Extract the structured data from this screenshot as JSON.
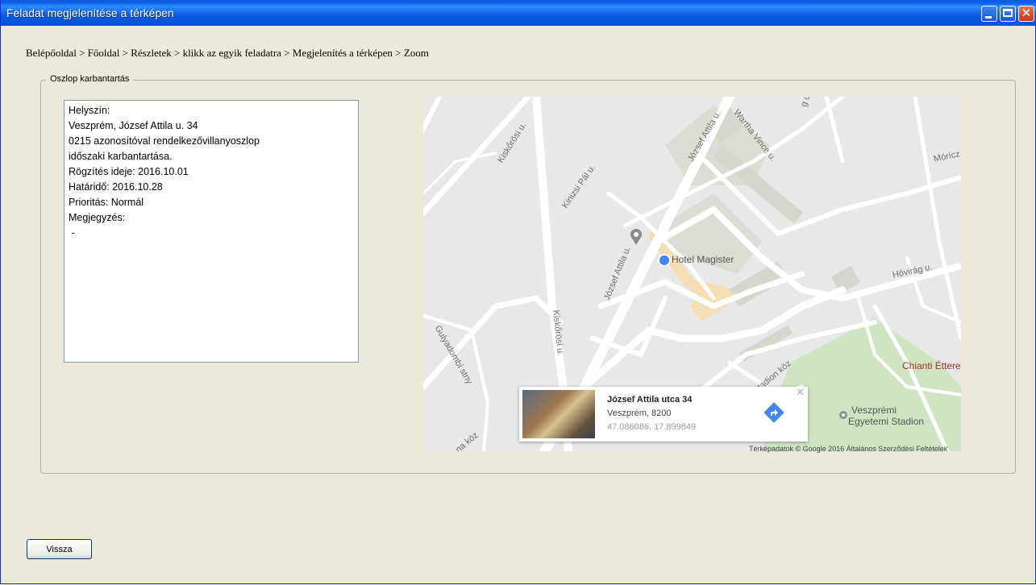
{
  "window": {
    "title": "Feladat megjelenítése a térképen",
    "minimize_symbol": "",
    "maximize_symbol": "",
    "close_symbol": "✕"
  },
  "breadcrumb": "Belépőoldal > Főoldal > Részletek > klikk az egyik feladatra > Megjelenítés a térképen  > Zoom",
  "group": {
    "legend": "Oszlop karbantartás",
    "lines": [
      "Helyszín:",
      "Veszprém, József Attila u. 34",
      "0215 azonosítóval rendelkezővillanyoszlop",
      "időszaki karbantartása.",
      "Rögzítés ideje: 2016.10.01",
      "Határidő: 2016.10.28",
      "Prioritás: Normál",
      "Megjegyzés:",
      " -"
    ]
  },
  "map": {
    "street_labels": {
      "kiskorosi_top": "Kiskőrösi u.",
      "kinizsi": "Kinizsi Pál u.",
      "jozsef_attila_top": "József Attila u.",
      "wartha": "Wartha Vince u.",
      "moricz": "Mórícz",
      "hovirag": "Hóvirág u.",
      "jozsef_attila_left": "József Attila u.",
      "kiskorosi_mid": "Kiskőrösi u.",
      "gulyadombi": "Gulyadombi stny",
      "stadion": "Stadion köz",
      "bottom_left": "na köz",
      "top_right_fragment": "g u."
    },
    "poi": {
      "hotel": "Hotel Magister",
      "restaurant": "Chianti Étterem",
      "stadium_line1": "Veszprémi",
      "stadium_line2": "Egyetemi Stadion"
    },
    "card": {
      "title": "József Attila utca 34",
      "city": "Veszprém, 8200",
      "coords": "47.086086, 17.899849",
      "close": "✕"
    },
    "attribution": "Térképadatok © Google 2016    Általános Szerződési Feltételek"
  },
  "back_button": "Vissza",
  "colors": {
    "window_bg": "#ECE9D8",
    "titlebar": "#0A5BE0",
    "map_bg": "#E8E8E8",
    "park": "#CFE5C2",
    "building": "#D8D8CE",
    "hotel_building": "#F5DEB3",
    "location_dot": "#4285F4"
  }
}
